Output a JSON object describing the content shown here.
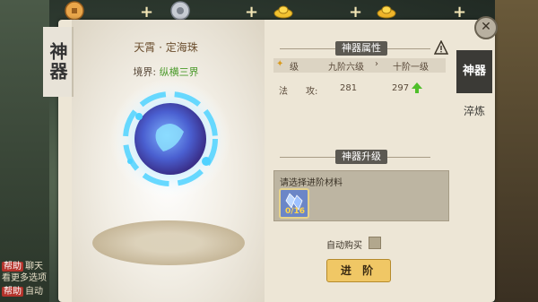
{
  "topbar": {
    "currencies": [
      {
        "icon": "copper-coin-icon",
        "color": "#e9a64a"
      },
      {
        "icon": "silver-coin-icon",
        "color": "#c7ccd3"
      },
      {
        "icon": "gold-ingot-icon",
        "color": "#f2c230"
      },
      {
        "icon": "gold-ingot-2-icon",
        "color": "#f0b52a"
      }
    ],
    "plus": "+"
  },
  "left_panel": {
    "help_lines": [
      {
        "tag": "帮助",
        "text": "聊天"
      },
      {
        "tag": "",
        "text": "看更多选项"
      },
      {
        "tag": "帮助",
        "text": "自动"
      }
    ]
  },
  "panel": {
    "vertical_title": "神器",
    "item_name": "天霄 · 定海珠",
    "realm_label": "境界:",
    "realm_value": "纵横三界",
    "attr_section": "神器属性",
    "level": {
      "label": "级",
      "current": "九阶六级",
      "arrow": "›",
      "next": "十阶一级"
    },
    "attr": {
      "name": "法　　攻:",
      "current": "281",
      "next": "297"
    },
    "upgrade_section": "神器升级",
    "materials_label": "请选择进阶材料",
    "material_count": "0/16",
    "auto_buy_label": "自动购买",
    "advance_button": "进 阶"
  },
  "tabs": {
    "active": "神器",
    "other": "淬炼"
  },
  "close": "✕"
}
